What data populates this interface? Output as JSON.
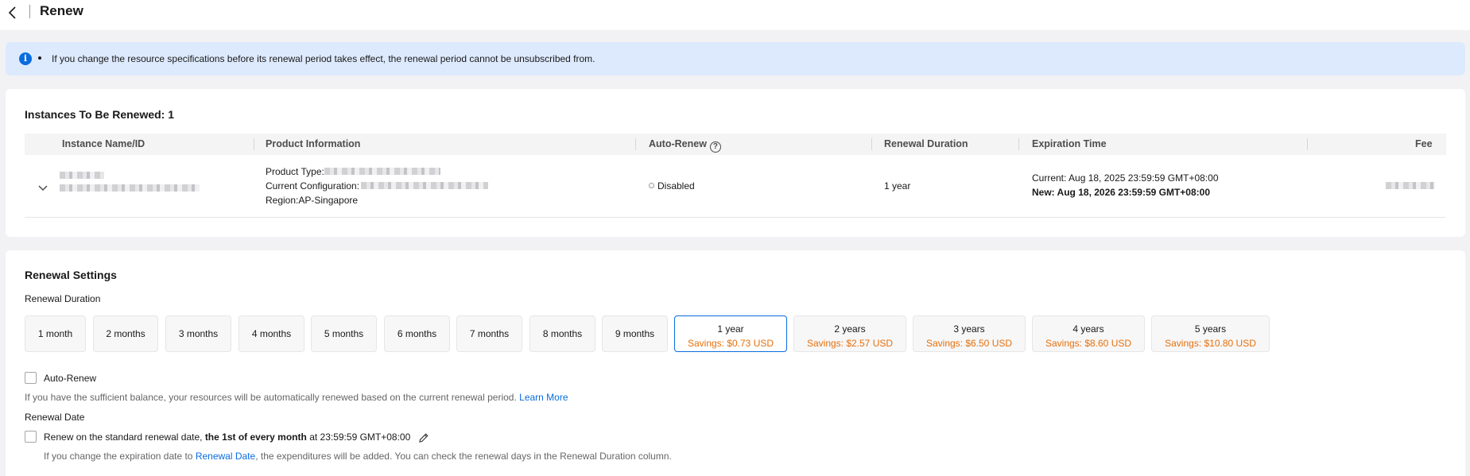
{
  "header": {
    "title": "Renew"
  },
  "notice": {
    "text": "If you change the resource specifications before its renewal period takes effect, the renewal period cannot be unsubscribed from."
  },
  "instances": {
    "title": "Instances To Be Renewed: 1",
    "columns": [
      "Instance Name/ID",
      "Product Information",
      "Auto-Renew",
      "Renewal Duration",
      "Expiration Time",
      "Fee"
    ],
    "row": {
      "product_type_label": "Product Type:",
      "current_config_label": "Current Configuration:",
      "region": "Region:AP-Singapore",
      "auto_renew": "Disabled",
      "renewal_duration": "1 year",
      "expiration_current": "Current: Aug 18, 2025 23:59:59 GMT+08:00",
      "expiration_new": "New: Aug 18, 2026 23:59:59 GMT+08:00"
    }
  },
  "settings": {
    "title": "Renewal Settings",
    "duration_label": "Renewal Duration",
    "durations": [
      {
        "label": "1 month",
        "savings": ""
      },
      {
        "label": "2 months",
        "savings": ""
      },
      {
        "label": "3 months",
        "savings": ""
      },
      {
        "label": "4 months",
        "savings": ""
      },
      {
        "label": "5 months",
        "savings": ""
      },
      {
        "label": "6 months",
        "savings": ""
      },
      {
        "label": "7 months",
        "savings": ""
      },
      {
        "label": "8 months",
        "savings": ""
      },
      {
        "label": "9 months",
        "savings": ""
      },
      {
        "label": "1 year",
        "savings": "Savings: $0.73 USD"
      },
      {
        "label": "2 years",
        "savings": "Savings: $2.57 USD"
      },
      {
        "label": "3 years",
        "savings": "Savings: $6.50 USD"
      },
      {
        "label": "4 years",
        "savings": "Savings: $8.60 USD"
      },
      {
        "label": "5 years",
        "savings": "Savings: $10.80 USD"
      }
    ],
    "selected_duration": "1 year",
    "auto_renew_label": "Auto-Renew",
    "auto_renew_desc": "If you have the sufficient balance, your resources will be automatically renewed based on the current renewal period.",
    "learn_more": "Learn More",
    "renewal_date_label": "Renewal Date",
    "renewal_date_prefix": "Renew on the standard renewal date,",
    "renewal_date_bold": "the 1st of every month",
    "renewal_date_suffix": "at 23:59:59 GMT+08:00",
    "renewal_date_note_prefix": "If you change the expiration date to",
    "renewal_date_note_link": "Renewal Date",
    "renewal_date_note_suffix": ", the expenditures will be added. You can check the renewal days in the Renewal Duration column."
  },
  "colors": {
    "accent": "#0a6cde",
    "savings": "#e6700b",
    "notice_bg": "#ddeafd"
  }
}
